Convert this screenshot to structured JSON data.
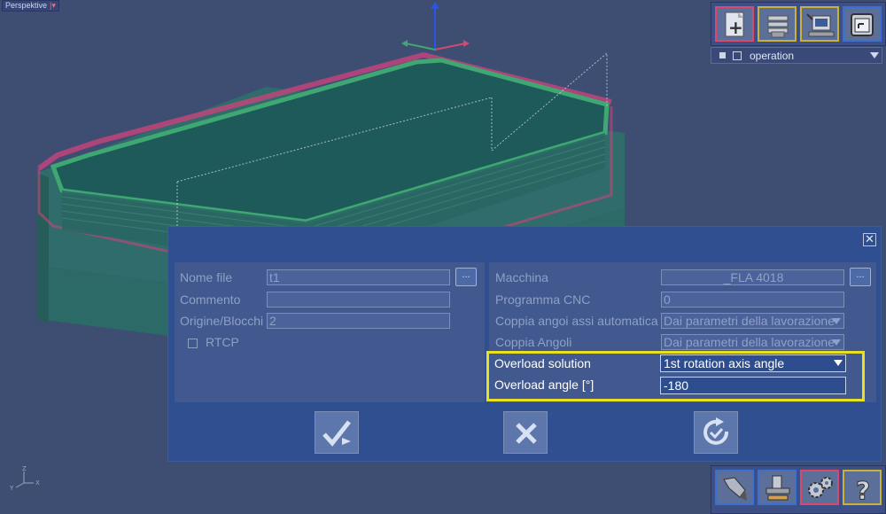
{
  "viewport": {
    "label": "Perspektive"
  },
  "toolbar_top": {
    "buttons": [
      {
        "name": "new-file",
        "icon": "new-file-icon",
        "color": "#d94a6a"
      },
      {
        "name": "layers",
        "icon": "layers-icon",
        "color": "#c9b23a"
      },
      {
        "name": "machine-terminal",
        "icon": "machine-terminal-icon",
        "color": "#c9b23a"
      },
      {
        "name": "view-window",
        "icon": "view-window-icon",
        "color": "#3b6fd0"
      }
    ],
    "operation_select": {
      "value": "operation"
    }
  },
  "dialog": {
    "left": {
      "filename_label": "Nome file",
      "filename_value": "t1",
      "comment_label": "Commento",
      "comment_value": "",
      "origin_label": "Origine/Blocchi",
      "origin_value": "2",
      "rtcp_label": "RTCP",
      "browse_label": "..."
    },
    "right": {
      "machine_label": "Macchina",
      "machine_value": "_FLA 4018",
      "program_label": "Programma CNC",
      "program_value": "0",
      "axis_pair_label": "Coppia angoi assi automatica",
      "axis_pair_value": "Dai parametri della lavorazione",
      "angle_pair_label": "Coppia Angoli",
      "angle_pair_value": "Dai parametri della lavorazione",
      "overload_solution_label": "Overload solution",
      "overload_solution_value": "1st rotation axis angle",
      "overload_angle_label": "Overload angle [°]",
      "overload_angle_value": "-180",
      "browse_label": "..."
    },
    "actions": [
      "confirm-icon",
      "cancel-icon",
      "refresh-icon"
    ],
    "highlight_color": "#e8e020"
  },
  "toolbar_bottom": {
    "buttons": [
      {
        "name": "tool",
        "icon": "tool-icon",
        "color": "#3b6fd0"
      },
      {
        "name": "machine-head",
        "icon": "machine-head-icon",
        "color": "#3b6fd0"
      },
      {
        "name": "settings",
        "icon": "gears-icon",
        "color": "#d94a6a"
      },
      {
        "name": "help",
        "icon": "help-icon",
        "color": "#c9b23a"
      }
    ]
  }
}
